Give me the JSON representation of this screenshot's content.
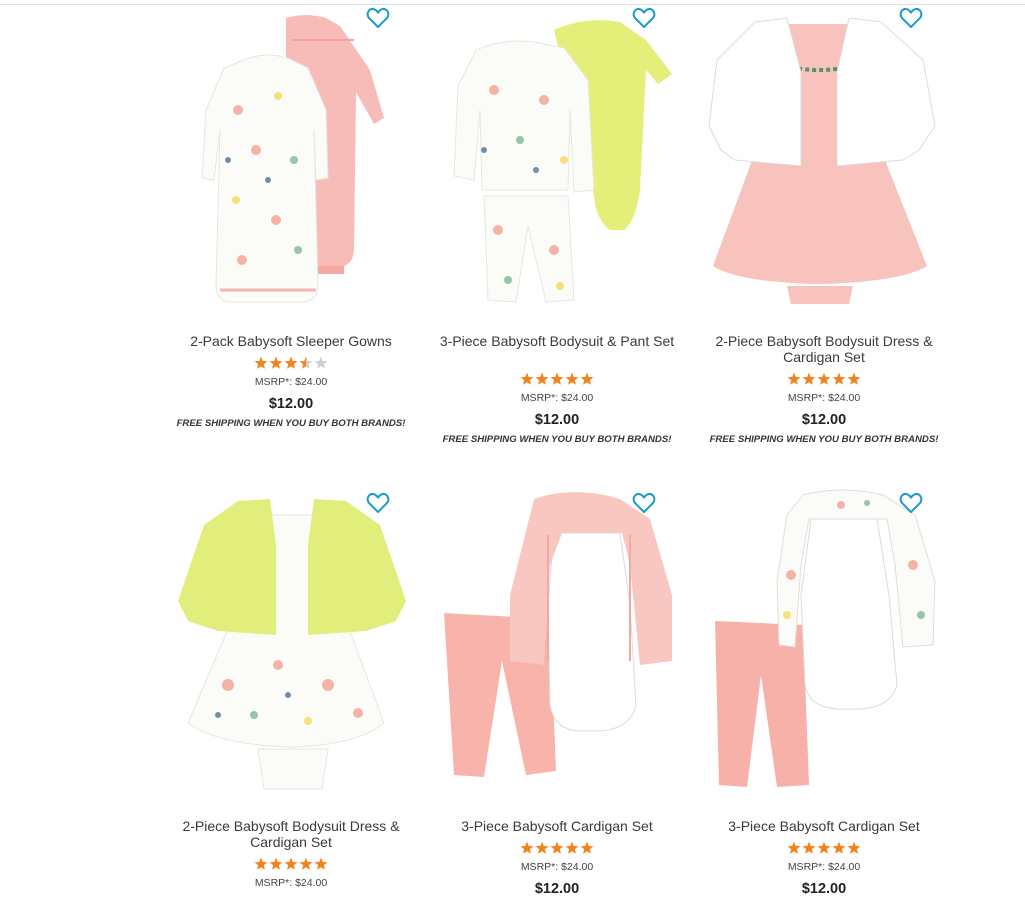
{
  "colors": {
    "accent_heart": "#1a9ccc",
    "star_filled": "#f2821c",
    "star_empty": "#cfcfcf",
    "pink": "#f8b8b3",
    "lime": "#e4ef7a",
    "white_floral": "#fbfbf8"
  },
  "products": [
    {
      "title": "2-Pack Babysoft Sleeper Gowns",
      "rating": 3.5,
      "msrp": "MSRP*: $24.00",
      "price": "$12.00",
      "shipping": "FREE SHIPPING WHEN YOU BUY BOTH BRANDS!",
      "favorite_icon": "heart-outline-icon",
      "image": "sleeper-gowns-image"
    },
    {
      "title": "3-Piece Babysoft Bodysuit & Pant Set",
      "rating": 5,
      "msrp": "MSRP*: $24.00",
      "price": "$12.00",
      "shipping": "FREE SHIPPING WHEN YOU BUY BOTH BRANDS!",
      "favorite_icon": "heart-outline-icon",
      "image": "bodysuit-pant-set-image"
    },
    {
      "title": "2-Piece Babysoft Bodysuit Dress & Cardigan Set",
      "rating": 5,
      "msrp": "MSRP*: $24.00",
      "price": "$12.00",
      "shipping": "FREE SHIPPING WHEN YOU BUY BOTH BRANDS!",
      "favorite_icon": "heart-outline-icon",
      "image": "pink-dress-cardigan-image"
    },
    {
      "title": "2-Piece Babysoft Bodysuit Dress & Cardigan Set",
      "rating": 5,
      "msrp": "MSRP*: $24.00",
      "price": "",
      "shipping": "",
      "favorite_icon": "heart-outline-icon",
      "image": "floral-dress-yellow-cardigan-image"
    },
    {
      "title": "3-Piece Babysoft Cardigan Set",
      "rating": 5,
      "msrp": "MSRP*: $24.00",
      "price": "$12.00",
      "shipping": "",
      "favorite_icon": "heart-outline-icon",
      "image": "pink-cardigan-set-image"
    },
    {
      "title": "3-Piece Babysoft Cardigan Set",
      "rating": 5,
      "msrp": "MSRP*: $24.00",
      "price": "$12.00",
      "shipping": "",
      "favorite_icon": "heart-outline-icon",
      "image": "floral-cardigan-set-image"
    }
  ]
}
